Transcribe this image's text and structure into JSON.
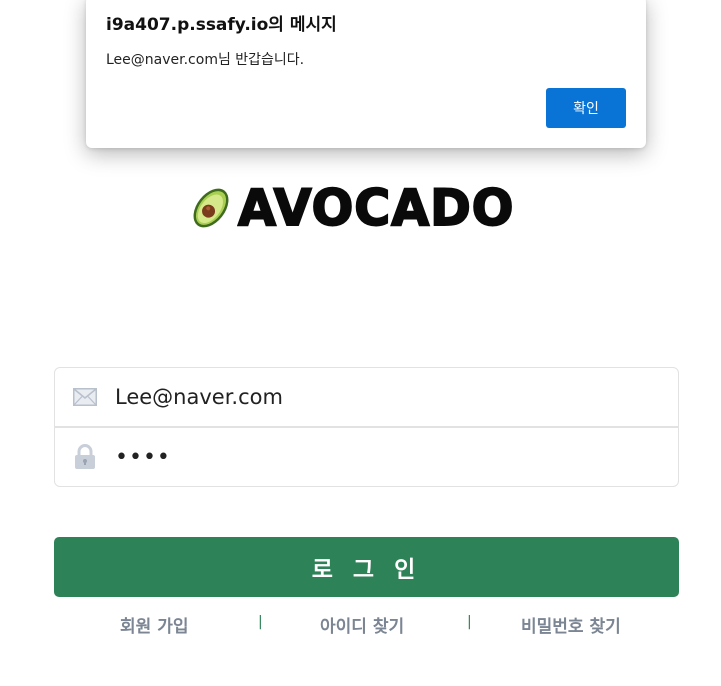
{
  "logo": {
    "icon": "avocado-icon",
    "text": "AVOCADO"
  },
  "login_form": {
    "email_value": "Lee@naver.com",
    "password_value": "••••",
    "email_icon": "envelope-icon",
    "password_icon": "lock-icon",
    "submit_label": "로 그 인"
  },
  "links": {
    "signup": "회원 가입",
    "find_id": "아이디 찾기",
    "find_password": "비밀번호 찾기",
    "separator": "|"
  },
  "alert": {
    "title": "i9a407.p.ssafy.io의 메시지",
    "message": "Lee@naver.com님 반갑습니다.",
    "ok_label": "확인"
  },
  "colors": {
    "primary_green": "#2e8257",
    "dialog_button_blue": "#0a74d6",
    "link_gray": "#7b8593"
  }
}
